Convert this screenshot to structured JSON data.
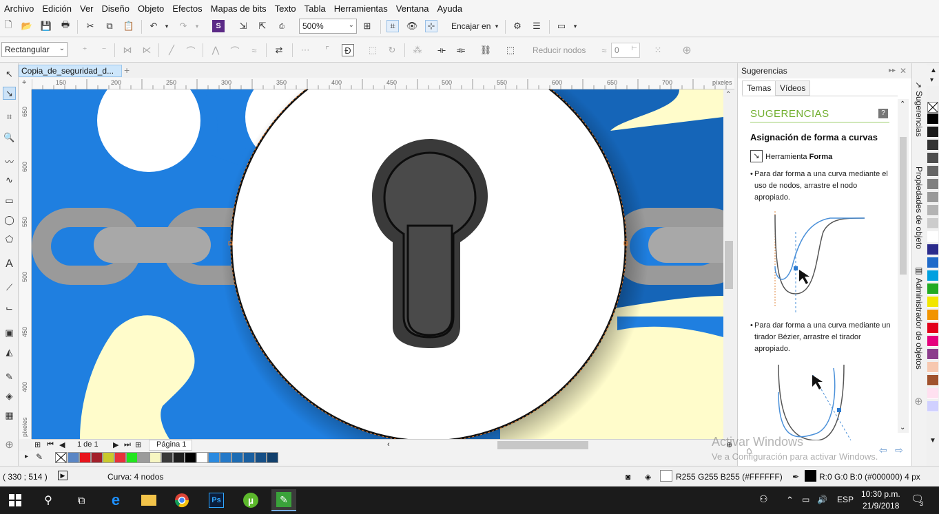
{
  "menu": [
    "Archivo",
    "Edición",
    "Ver",
    "Diseño",
    "Objeto",
    "Efectos",
    "Mapas de bits",
    "Texto",
    "Tabla",
    "Herramientas",
    "Ventana",
    "Ayuda"
  ],
  "toolbar": {
    "zoom": "500%",
    "snap_label": "Encajar en"
  },
  "propbar": {
    "shape_mode": "Rectangular",
    "reduce_nodes": "Reducir nodos",
    "curve_smoothing": "0"
  },
  "document": {
    "tab_title": "Copia_de_seguridad_d...",
    "page_counter": "1 de 1",
    "page_tab": "Página 1",
    "units": "píxeles"
  },
  "ruler": {
    "h_ticks": [
      "150",
      "200",
      "250",
      "300",
      "350",
      "400",
      "450",
      "500",
      "550",
      "600",
      "650",
      "700"
    ],
    "v_ticks": [
      "650",
      "600",
      "550",
      "500",
      "450",
      "400"
    ]
  },
  "status": {
    "coords": "( 330  ; 514  )",
    "selection": "Curva: 4 nodos",
    "fill_label": "R255 G255 B255 (#FFFFFF)",
    "outline_label": "R:0 G:0 B:0 (#000000)  4 px"
  },
  "docker": {
    "header": "Sugerencias",
    "tabs": [
      "Temas",
      "Vídeos"
    ],
    "section": "SUGERENCIAS",
    "heading": "Asignación de forma a curvas",
    "tool_prefix": "Herramienta",
    "tool_name": "Forma",
    "para1": "Para dar forma a una curva mediante el uso de nodos, arrastre el nodo apropiado.",
    "para2": "Para dar forma a una curva mediante un tirador Bézier, arrastre el tirador apropiado."
  },
  "side_tabs": [
    "Sugerencias",
    "Propiedades de objeto",
    "Administrador de objetos"
  ],
  "watermark": {
    "line1": "Activar Windows",
    "line2": "Ve a Configuración para activar Windows."
  },
  "taskbar": {
    "language": "ESP",
    "time": "10:30 p.m.",
    "date": "21/9/2018",
    "notifications": "3"
  },
  "icons": [
    "pick-tool-icon",
    "shape-tool-icon",
    "crop-icon",
    "zoom-icon",
    "freehand-icon",
    "rectangle-icon",
    "ellipse-icon",
    "polygon-icon",
    "text-icon",
    "eyedropper-icon",
    "fill-icon"
  ],
  "colors": {
    "canvas_blue": "#1f7fe0",
    "dark_blue": "#1565b8",
    "cream": "#fffccb",
    "chain_gray": "#9a9a9a",
    "key_dark": "#4a4a4a",
    "hint_green": "#6fae2c",
    "tab_blue": "#cde6fb"
  },
  "palette_bottom": [
    "#5a86c5",
    "#e8141c",
    "#a3202a",
    "#c9c92c",
    "#e8313a",
    "#22e51e",
    "#9b9b9b",
    "#f7f6c2",
    "#3a3a3a",
    "#1e1e1e",
    "#000000",
    "#ffffff",
    "#2a8ae0",
    "#2479c8",
    "#1d6cb3",
    "#1a5fa0",
    "#164f86",
    "#12406c"
  ],
  "palette_right": [
    "#000000",
    "#1a1a1a",
    "#333333",
    "#4d4d4d",
    "#666666",
    "#808080",
    "#999999",
    "#b3b3b3",
    "#cccccc",
    "#ffffff",
    "#2b2b8c",
    "#1f6ac9",
    "#00a0e0",
    "#22aa22",
    "#f2e600",
    "#f29400",
    "#e3001b",
    "#e5007e",
    "#8c3c8c",
    "#f7c8b0",
    "#a0522d",
    "#ffe0f0",
    "#d0d0ff"
  ]
}
